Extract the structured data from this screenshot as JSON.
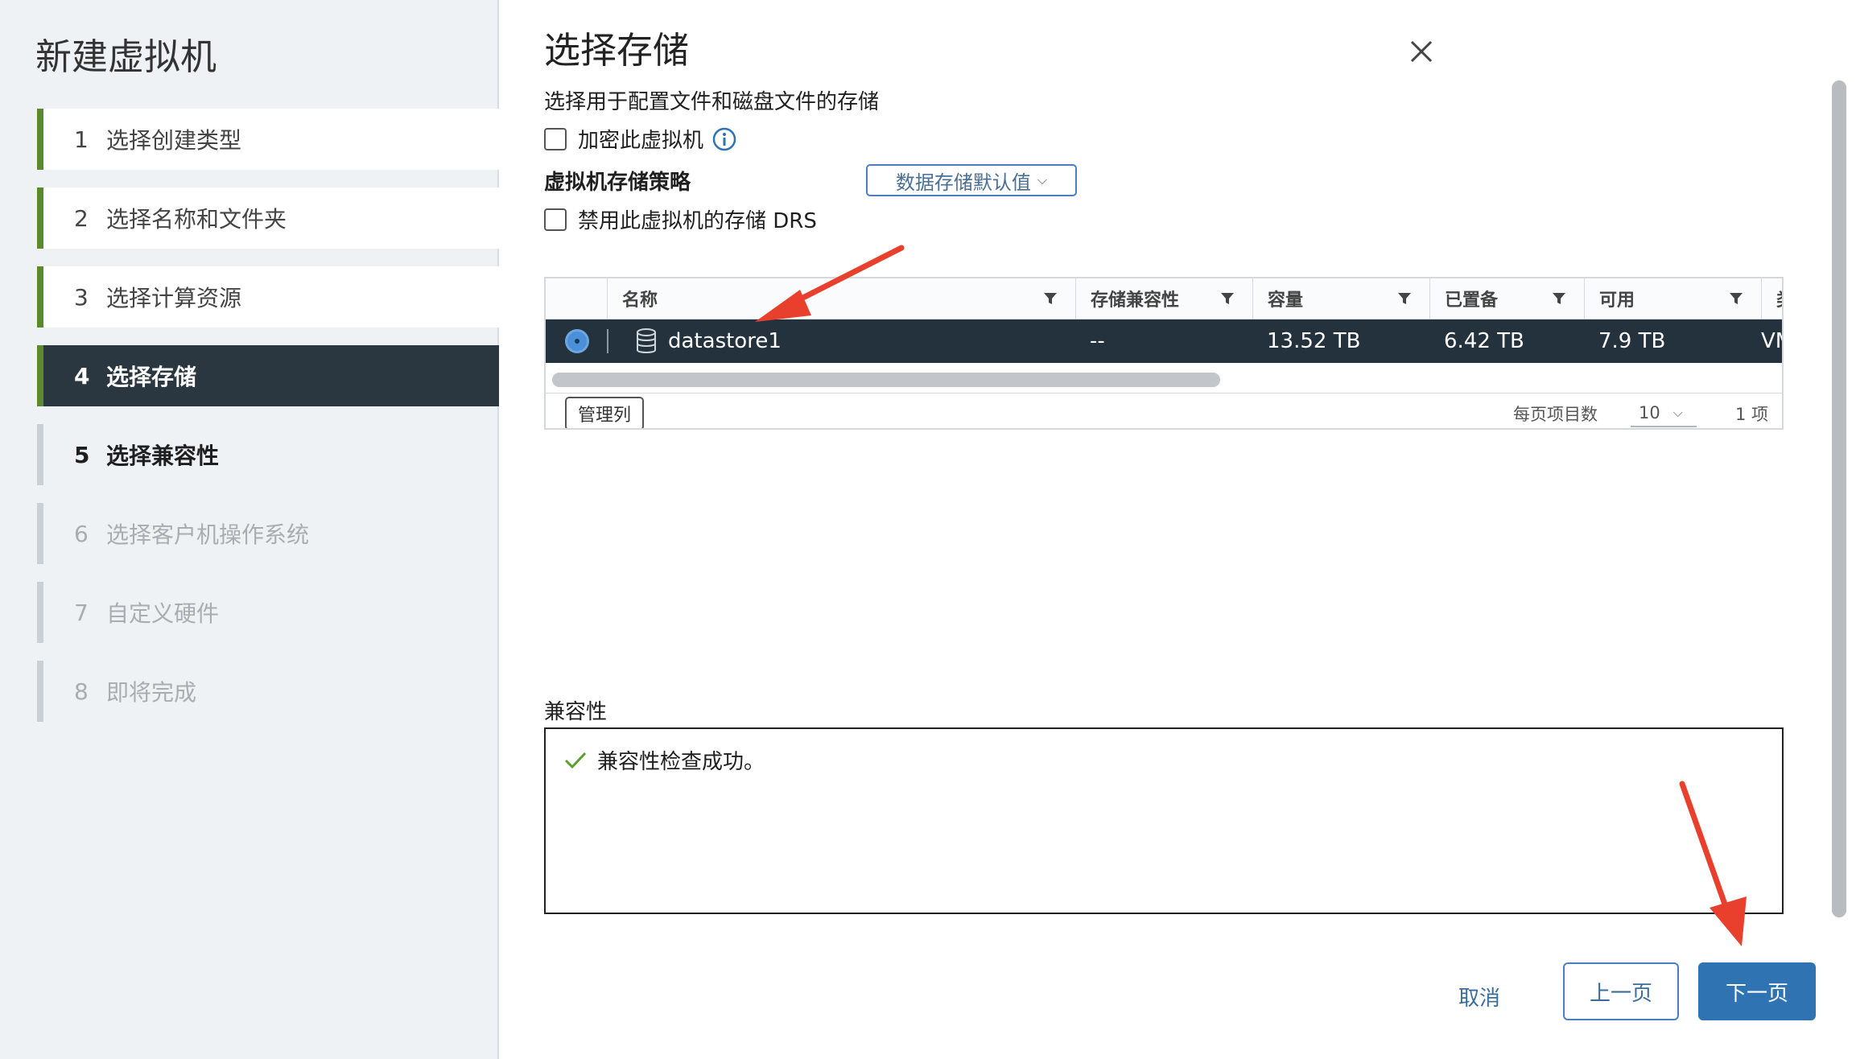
{
  "wizard": {
    "title": "新建虚拟机",
    "steps": [
      {
        "num": "1",
        "label": "选择创建类型",
        "state": "done"
      },
      {
        "num": "2",
        "label": "选择名称和文件夹",
        "state": "done"
      },
      {
        "num": "3",
        "label": "选择计算资源",
        "state": "done"
      },
      {
        "num": "4",
        "label": "选择存储",
        "state": "active"
      },
      {
        "num": "5",
        "label": "选择兼容性",
        "state": "next"
      },
      {
        "num": "6",
        "label": "选择客户机操作系统",
        "state": "disabled"
      },
      {
        "num": "7",
        "label": "自定义硬件",
        "state": "disabled"
      },
      {
        "num": "8",
        "label": "即将完成",
        "state": "disabled"
      }
    ]
  },
  "page": {
    "title": "选择存储",
    "subtitle": "选择用于配置文件和磁盘文件的存储",
    "encrypt_label": "加密此虚拟机",
    "encrypt_checked": false,
    "policy_label": "虚拟机存储策略",
    "policy_value": "数据存储默认值",
    "disable_drs_label": "禁用此虚拟机的存储 DRS",
    "disable_drs_checked": false
  },
  "grid": {
    "columns": [
      "名称",
      "存储兼容性",
      "容量",
      "已置备",
      "可用",
      "类"
    ],
    "rows": [
      {
        "name": "datastore1",
        "compat": "--",
        "capacity": "13.52 TB",
        "provisioned": "6.42 TB",
        "free": "7.9 TB",
        "type": "VM",
        "selected": true
      }
    ],
    "manage_columns_label": "管理列",
    "per_page_label": "每页项目数",
    "per_page_value": "10",
    "item_count": "1 项"
  },
  "compatibility": {
    "label": "兼容性",
    "message": "兼容性检查成功。"
  },
  "footer": {
    "cancel_label": "取消",
    "back_label": "上一页",
    "next_label": "下一页"
  },
  "colors": {
    "sidebar_bg": "#eef2f5",
    "active_step_bg": "#2a3640",
    "progress_green": "#5b8a2e",
    "primary_blue": "#2f73b3",
    "annotation_red": "#e8402c"
  }
}
